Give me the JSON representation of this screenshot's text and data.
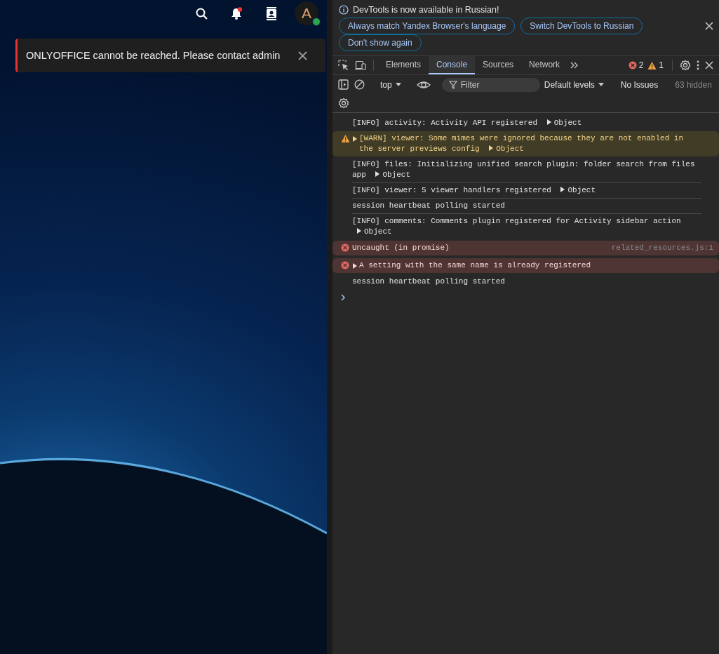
{
  "app": {
    "header": {
      "notifications_unread": true,
      "avatar_letter": "A",
      "avatar_online": true
    },
    "toast": {
      "text": "ONLYOFFICE cannot be reached. Please contact admin"
    }
  },
  "devtools": {
    "banner": {
      "message": "DevTools is now available in Russian!",
      "buttons": [
        "Always match Yandex Browser's language",
        "Switch DevTools to Russian",
        "Don't show again"
      ]
    },
    "tabs": [
      {
        "label": "Elements",
        "selected": false
      },
      {
        "label": "Console",
        "selected": true
      },
      {
        "label": "Sources",
        "selected": false
      },
      {
        "label": "Network",
        "selected": false
      }
    ],
    "error_count": "2",
    "warning_count": "1",
    "toolbar": {
      "context": "top",
      "filter_placeholder": "Filter",
      "levels": "Default levels",
      "issues": "No Issues",
      "hidden": "63 hidden"
    },
    "messages": [
      {
        "kind": "info",
        "expandable": false,
        "text": "[INFO] activity: Activity API registered",
        "object": "Object"
      },
      {
        "kind": "warn",
        "expandable": true,
        "text": "[WARN] viewer: Some mimes were ignored because they are not enabled in the server previews config",
        "object": "Object"
      },
      {
        "kind": "info",
        "expandable": false,
        "text": "[INFO] files: Initializing unified search plugin: folder search from files app",
        "object": "Object"
      },
      {
        "kind": "info",
        "expandable": false,
        "text": "[INFO] viewer: 5 viewer handlers registered",
        "object": "Object"
      },
      {
        "kind": "info",
        "expandable": false,
        "text": "session heartbeat polling started"
      },
      {
        "kind": "info",
        "expandable": false,
        "text": "[INFO] comments: Comments plugin registered for Activity sidebar action",
        "object": "Object"
      },
      {
        "kind": "error",
        "expandable": false,
        "text": "Uncaught (in promise)",
        "source": "related_resources.js:1"
      },
      {
        "kind": "error",
        "expandable": true,
        "text": "A setting with the same name is already registered"
      },
      {
        "kind": "info",
        "expandable": false,
        "text": "session heartbeat polling started"
      }
    ]
  }
}
